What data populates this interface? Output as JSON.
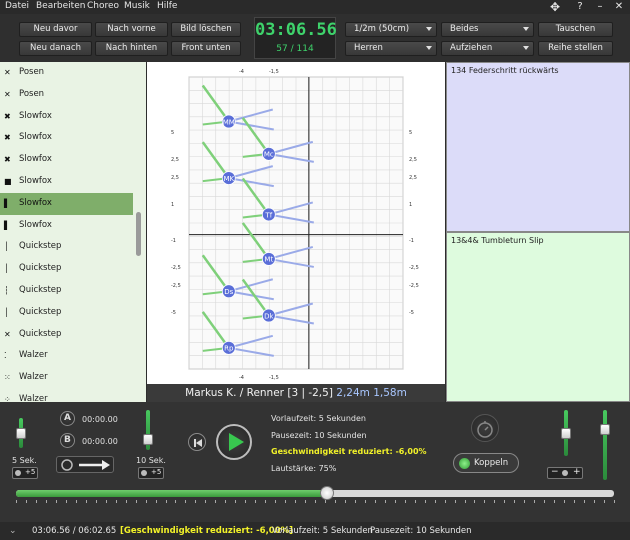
{
  "menu": [
    "Datei",
    "Bearbeiten",
    "Choreo",
    "Musik",
    "Hilfe"
  ],
  "toolbar": {
    "buttons_left": [
      "Neu davor",
      "Nach vorne",
      "Bild löschen",
      "Neu danach",
      "Nach hinten",
      "Front unten"
    ],
    "timer": "03:06.56",
    "frame_counter": "57 / 114",
    "combo_scale": "1/2m  (50cm)",
    "combo_mode": "Beides",
    "combo_group": "Herren",
    "combo_action": "Aufziehen",
    "swap_button": "Tauschen",
    "row_button": "Reihe stellen",
    "icons": [
      "move-icon",
      "help-icon",
      "minimize-icon",
      "close-icon"
    ]
  },
  "list": {
    "items": [
      {
        "label": "Posen",
        "selected": false
      },
      {
        "label": "Posen",
        "selected": false
      },
      {
        "label": "Slowfox",
        "selected": false
      },
      {
        "label": "Slowfox",
        "selected": false
      },
      {
        "label": "Slowfox",
        "selected": false
      },
      {
        "label": "Slowfox",
        "selected": false
      },
      {
        "label": "Slowfox",
        "selected": true
      },
      {
        "label": "Slowfox",
        "selected": false
      },
      {
        "label": "Quickstep",
        "selected": false
      },
      {
        "label": "Quickstep",
        "selected": false
      },
      {
        "label": "Quickstep",
        "selected": false
      },
      {
        "label": "Quickstep",
        "selected": false
      },
      {
        "label": "Quickstep",
        "selected": false
      },
      {
        "label": "Walzer",
        "selected": false
      },
      {
        "label": "Walzer",
        "selected": false
      },
      {
        "label": "Walzer",
        "selected": false
      }
    ]
  },
  "formation": {
    "dancers": [
      {
        "id": "MM",
        "x": -1.6,
        "y": 2.8
      },
      {
        "id": "Mc",
        "x": -0.8,
        "y": 2.0
      },
      {
        "id": "MK",
        "x": -1.6,
        "y": 1.4
      },
      {
        "id": "Tf",
        "x": -0.8,
        "y": 0.5
      },
      {
        "id": "Mt",
        "x": -0.8,
        "y": -0.6
      },
      {
        "id": "Ds",
        "x": -1.6,
        "y": -1.4
      },
      {
        "id": "Dk",
        "x": -0.8,
        "y": -2.0
      },
      {
        "id": "Rp",
        "x": -1.6,
        "y": -2.8
      }
    ],
    "top_labels": [
      "-4",
      "-1,5"
    ],
    "bottom_labels": [
      "-4",
      "-1,5"
    ],
    "left_labels": [
      "5",
      "2,5",
      "2,5",
      "1",
      "-1",
      "-2,5",
      "-2,5",
      "-5"
    ],
    "right_labels": [
      "5",
      "2,5",
      "2,5",
      "1",
      "-1",
      "-2,5",
      "-2,5",
      "-5"
    ],
    "colors": {
      "dancer": "#5a6ed8",
      "green_line": "#7fd07a",
      "blue_line": "#9aaae8"
    }
  },
  "center_status": {
    "names": "Markus K. / Renner",
    "coords": "[3 | -2,5]",
    "distance1": "2,24m",
    "distance2": "1,58m"
  },
  "panels": {
    "top_title": "134 Federschritt rückwärts",
    "bottom_title": "13&4& Tumbleturn Slip"
  },
  "controls": {
    "slider1_label": "5 Sek.",
    "slider2_label": "10 Sek.",
    "time_a": "00:00.00",
    "time_b": "00:00.00",
    "plus5": "+5",
    "info_lead": "Vorlaufzeit: 5 Sekunden",
    "info_pause": "Pausezeit: 10 Sekunden",
    "info_speed": "Geschwindigkeit reduziert: -6,00%",
    "info_volume": "Lautstärke: 75%",
    "couple_button": "Koppeln",
    "progress": 0.52
  },
  "statusbar": {
    "time": "03:06.56 / 06:02.65",
    "speed": "[Geschwindigkeit reduziert: -6,00%]",
    "lead": "Vorlaufzeit: 5 Sekunden",
    "pause": "Pausezeit: 10 Sekunden"
  }
}
